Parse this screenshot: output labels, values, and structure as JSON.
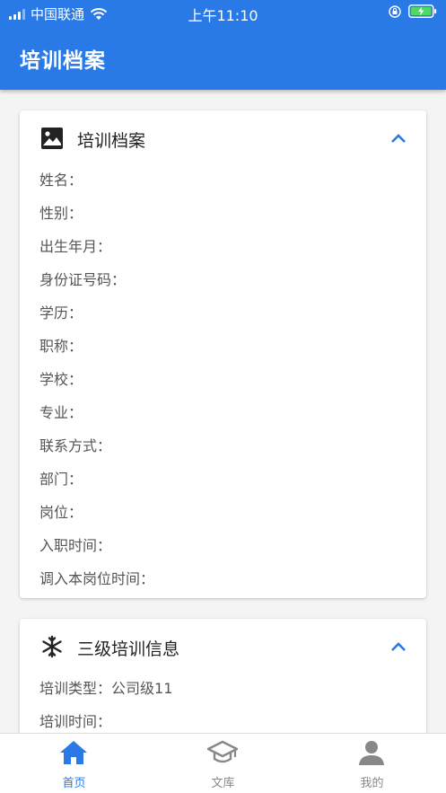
{
  "status_bar": {
    "carrier": "中国联通",
    "time": "上午11:10"
  },
  "header": {
    "title": "培训档案"
  },
  "profile_card": {
    "title": "培训档案",
    "icon": "image-icon",
    "fields": [
      {
        "label": "姓名：",
        "value": ""
      },
      {
        "label": "性别：",
        "value": ""
      },
      {
        "label": "出生年月：",
        "value": ""
      },
      {
        "label": "身份证号码：",
        "value": ""
      },
      {
        "label": "学历：",
        "value": ""
      },
      {
        "label": "职称：",
        "value": ""
      },
      {
        "label": "学校：",
        "value": ""
      },
      {
        "label": "专业：",
        "value": ""
      },
      {
        "label": "联系方式：",
        "value": ""
      },
      {
        "label": "部门：",
        "value": ""
      },
      {
        "label": "岗位：",
        "value": ""
      },
      {
        "label": "入职时间：",
        "value": ""
      },
      {
        "label": "调入本岗位时间：",
        "value": ""
      }
    ]
  },
  "training_card": {
    "title": "三级培训信息",
    "icon": "snowflake-icon",
    "fields": [
      {
        "label": "培训类型：",
        "value": "公司级11"
      },
      {
        "label": "培训时间：",
        "value": ""
      }
    ]
  },
  "tabbar": {
    "items": [
      {
        "label": "首页",
        "icon": "home-icon",
        "active": true
      },
      {
        "label": "文库",
        "icon": "graduation-cap-icon",
        "active": false
      },
      {
        "label": "我的",
        "icon": "user-icon",
        "active": false
      }
    ]
  },
  "colors": {
    "primary": "#2979e6",
    "background": "#f4f4f4",
    "inactive_tab": "#888888"
  }
}
